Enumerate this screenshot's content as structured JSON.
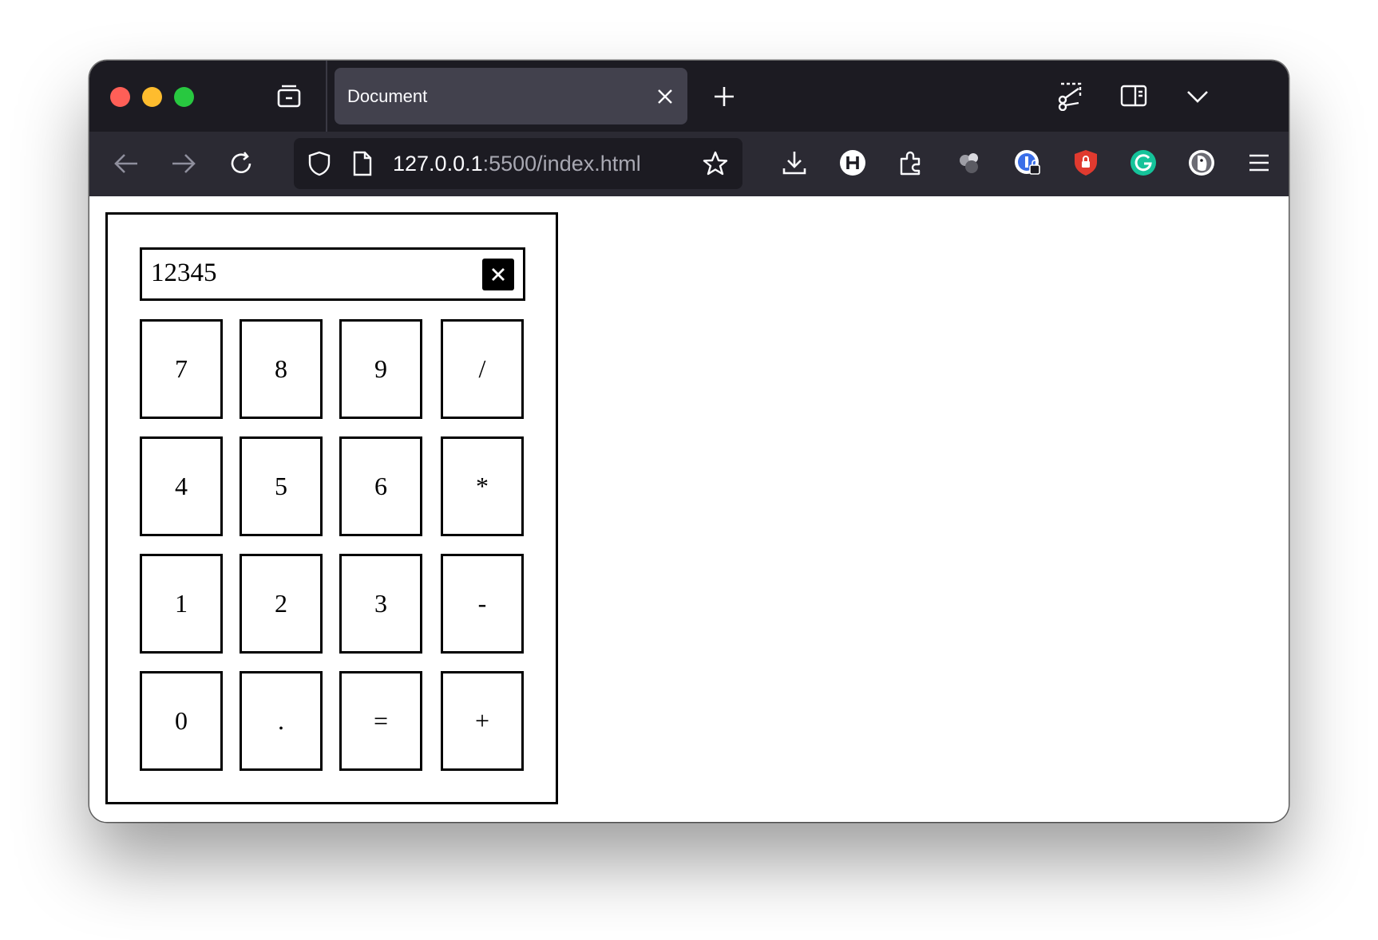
{
  "tab": {
    "title": "Document"
  },
  "url": {
    "host": "127.0.0.1",
    "rest": ":5500/index.html"
  },
  "calculator": {
    "display": "12345",
    "keys": [
      {
        "label": "7",
        "name": "key-7"
      },
      {
        "label": "8",
        "name": "key-8"
      },
      {
        "label": "9",
        "name": "key-9"
      },
      {
        "label": "/",
        "name": "key-divide"
      },
      {
        "label": "4",
        "name": "key-4"
      },
      {
        "label": "5",
        "name": "key-5"
      },
      {
        "label": "6",
        "name": "key-6"
      },
      {
        "label": "*",
        "name": "key-multiply"
      },
      {
        "label": "1",
        "name": "key-1"
      },
      {
        "label": "2",
        "name": "key-2"
      },
      {
        "label": "3",
        "name": "key-3"
      },
      {
        "label": "-",
        "name": "key-subtract"
      },
      {
        "label": "0",
        "name": "key-0"
      },
      {
        "label": ".",
        "name": "key-decimal"
      },
      {
        "label": "=",
        "name": "key-equals"
      },
      {
        "label": "+",
        "name": "key-add"
      }
    ]
  },
  "icons": {
    "tab_overview": "tab-overview-icon",
    "tab_close": "close-icon",
    "new_tab": "plus-icon",
    "screenshot": "screenshot-scissors-icon",
    "sidebar": "sidebar-icon",
    "tab_list": "chevron-down-icon",
    "back": "arrow-left-icon",
    "forward": "arrow-right-icon",
    "reload": "reload-icon",
    "tracking_protection": "shield-icon",
    "page_info": "page-icon",
    "bookmark": "star-icon",
    "downloads": "download-icon",
    "extensions": "puzzle-icon",
    "menu": "hamburger-menu-icon"
  },
  "colors": {
    "tab_bar": "#1c1b22",
    "active_tab": "#42414d",
    "toolbar": "#2b2a33",
    "url_field": "#1c1b22",
    "traffic_red": "#ff5f57",
    "traffic_yellow": "#febc2e",
    "traffic_green": "#28c840"
  }
}
